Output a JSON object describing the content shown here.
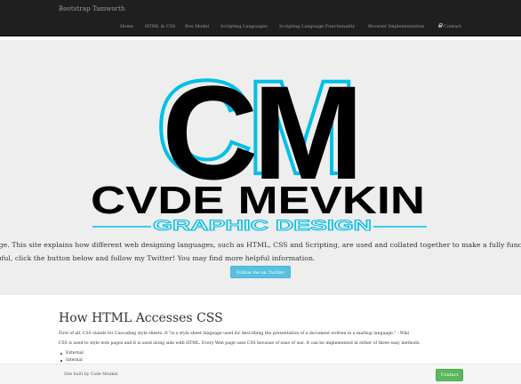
{
  "navbar": {
    "brand": "Bootstrap Tamworth",
    "items": [
      {
        "label": "Home"
      },
      {
        "label": "HTML & CSS"
      },
      {
        "label": "Box Model"
      },
      {
        "label": "Scripting Languages"
      },
      {
        "label": "Scripting Language Functionality"
      },
      {
        "label": "Browser Implementation"
      },
      {
        "label": "Contact",
        "icon": "lock-icon"
      }
    ]
  },
  "hero": {
    "logo": {
      "monogram": "CM",
      "name": "CVDE MEVKIN",
      "tagline": "GRAPHIC DESIGN",
      "colors": {
        "primary": "#000000",
        "accent": "#00c0e8"
      }
    },
    "intro_line1": "age. This site explains how different web designing languages, such as HTML, CSS and Scripting, are used and collated together to make a fully func",
    "intro_line2": "lpful, click the button below and follow my Twitter! You may find more helpful information.",
    "button_label": "Follow me on Twitter"
  },
  "content": {
    "heading": "How HTML Accesses CSS",
    "paragraph1": "First of all, CSS stands for Cascading style sheets. It \"is a style sheet language used for describing the presentation of a document written in a markup language.\" - Wiki",
    "paragraph2": "CSS is used to style web pages and it is used along side with HTML. Every Web page uses CSS because of ease of use. It can be implemented in either of three easy methods:",
    "methods": [
      "External",
      "Internal"
    ]
  },
  "footer": {
    "text": "Site built by Cade Meakin",
    "button_label": "Contact"
  }
}
